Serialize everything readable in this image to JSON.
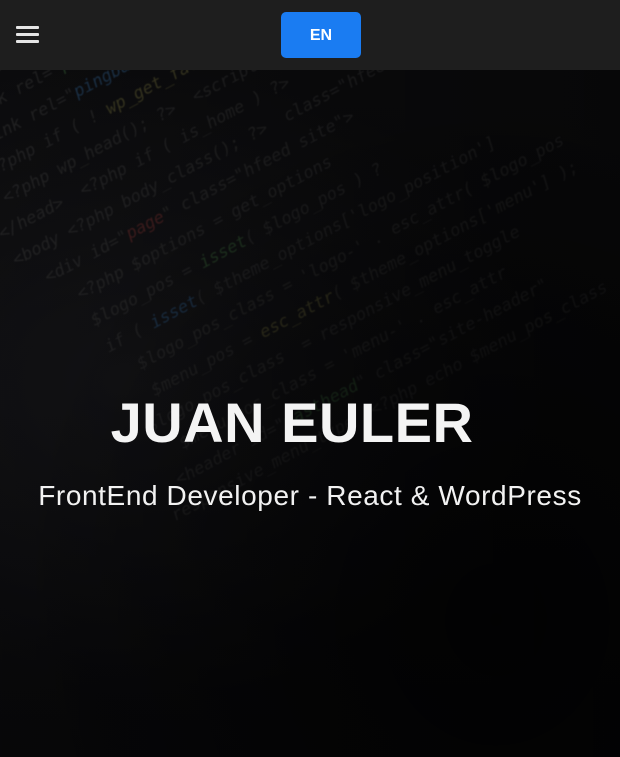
{
  "header": {
    "menu_icon": "hamburger-menu-icon",
    "language_label": "EN",
    "accent_color": "#1a7cf2",
    "background_color": "#1e1e1e"
  },
  "hero": {
    "name": "JUAN EULER",
    "role": "FrontEnd Developer - React & WordPress",
    "background": "blurred-code-editor-image"
  }
}
